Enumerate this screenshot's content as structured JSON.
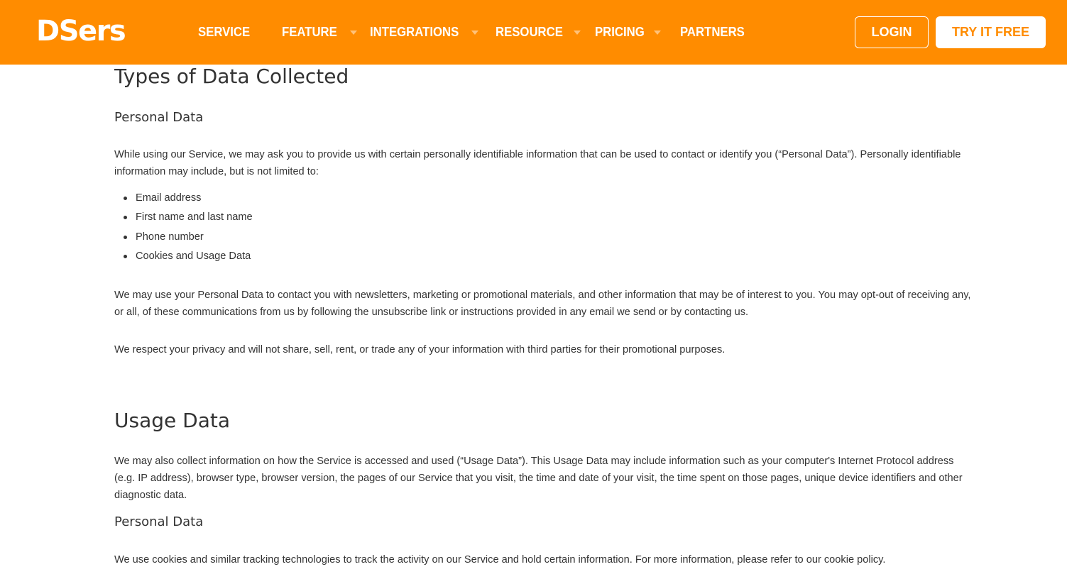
{
  "header": {
    "logo": "DSers",
    "brand_color": "#ff8c00",
    "nav": [
      {
        "label": "SERVICE",
        "has_dropdown": false
      },
      {
        "label": "FEATURE",
        "has_dropdown": true
      },
      {
        "label": "INTEGRATIONS",
        "has_dropdown": true
      },
      {
        "label": "RESOURCE",
        "has_dropdown": true
      },
      {
        "label": "PRICING",
        "has_dropdown": true
      },
      {
        "label": "PARTNERS",
        "has_dropdown": false
      }
    ],
    "login_label": "LOGIN",
    "try_label": "TRY IT FREE"
  },
  "content": {
    "section1": {
      "title": "Types of Data Collected",
      "subtitle": "Personal Data",
      "intro": "While using our Service, we may ask you to provide us with certain personally identifiable information that can be used to contact or identify you (“Personal Data”). Personally identifiable information may include, but is not limited to:",
      "list": [
        "Email address",
        "First name and last name",
        "Phone number",
        "Cookies and Usage Data"
      ],
      "para2": "We may use your Personal Data to contact you with newsletters, marketing or promotional materials, and other information that may be of interest to you. You may opt-out of receiving any, or all, of these communications from us by following the unsubscribe link or instructions provided in any email we send or by contacting us.",
      "para3": "We respect your privacy and will not share, sell, rent, or trade any of your information with third parties for their promotional purposes."
    },
    "section2": {
      "title": "Usage Data",
      "para1": "We may also collect information on how the Service is accessed and used (“Usage Data”). This Usage Data may include information such as your computer's Internet Protocol address (e.g. IP address), browser type, browser version, the pages of our Service that you visit, the time and date of your visit, the time spent on those pages, unique device identifiers and other diagnostic data.",
      "subtitle": "Personal Data",
      "para2": "We use cookies and similar tracking technologies to track the activity on our Service and hold certain information. For more information, please refer to our cookie policy."
    }
  }
}
